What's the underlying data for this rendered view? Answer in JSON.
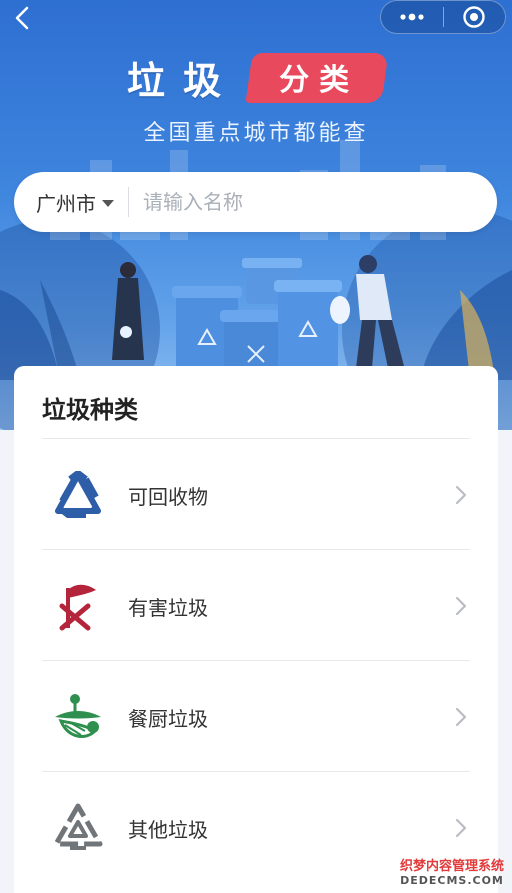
{
  "header": {
    "title_main": "垃圾",
    "title_badge": "分类",
    "subtitle": "全国重点城市都能查"
  },
  "nav": {
    "back_icon": "chevron-left-icon",
    "more_icon": "more-dots-icon",
    "close_icon": "target-circle-icon"
  },
  "search": {
    "city": "广州市",
    "placeholder": "请输入名称"
  },
  "categories": {
    "heading": "垃圾种类",
    "items": [
      {
        "label": "可回收物",
        "icon": "recycle-icon",
        "color": "#2e5ea8"
      },
      {
        "label": "有害垃圾",
        "icon": "hazardous-icon",
        "color": "#b4243b"
      },
      {
        "label": "餐厨垃圾",
        "icon": "kitchen-waste-icon",
        "color": "#2f8f4e"
      },
      {
        "label": "其他垃圾",
        "icon": "other-waste-icon",
        "color": "#707579"
      }
    ]
  },
  "watermark": {
    "line1": "织梦内容管理系统",
    "line2": "DEDECMS.COM"
  }
}
